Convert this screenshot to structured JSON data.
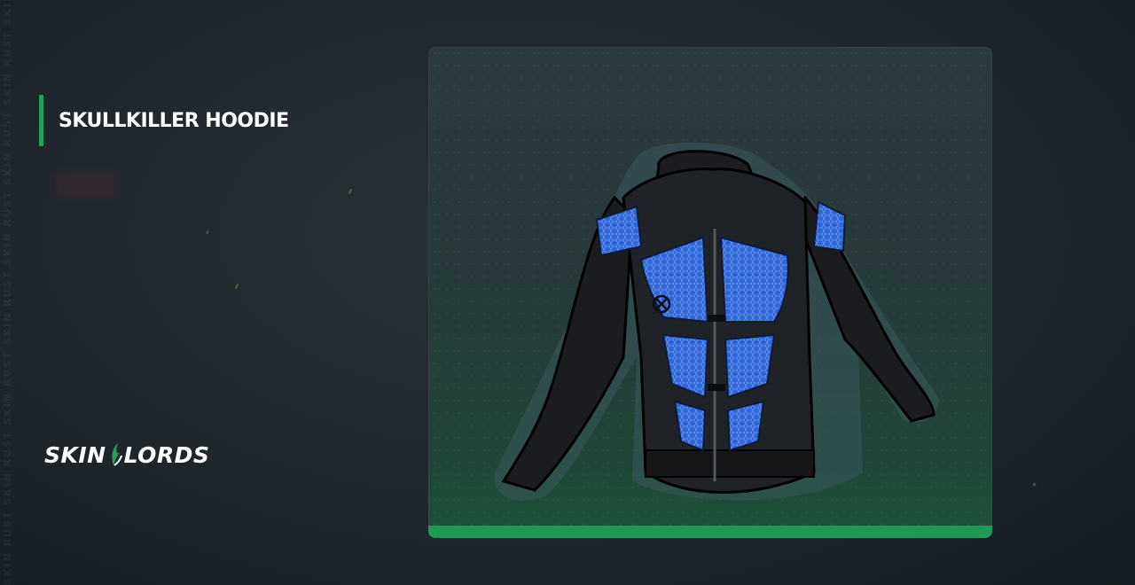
{
  "item": {
    "title": "SKULLKILLER HOODIE"
  },
  "brand": {
    "name_left": "SKIN",
    "name_right": "LORDS",
    "watermark": "SKIN RUST SKIN RUST SKIN RUST SKIN RUST SKIN RUST SKIN RUST SKIN RUST SKIN RUST SKIN RUST SKIN RUST"
  },
  "colors": {
    "accent": "#1fa35a",
    "background": "#1f272d",
    "card_bottom_bar": "#1f9a56",
    "armor_blue": "#2a5fd0"
  },
  "icons": {
    "logo": "skinlords-logo-icon",
    "item": "hoodie-image"
  }
}
